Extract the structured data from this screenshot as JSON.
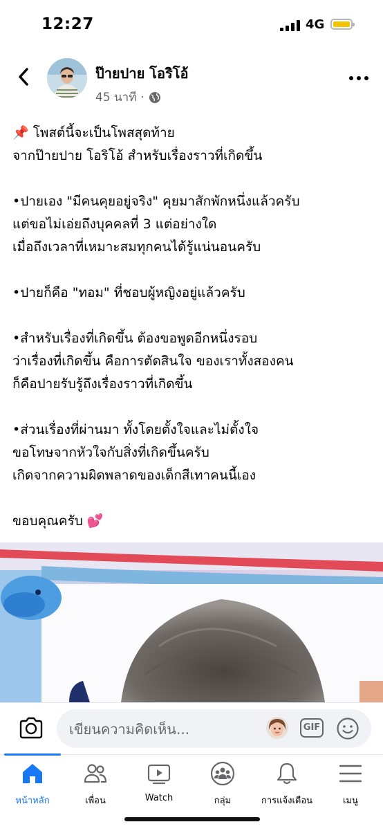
{
  "status_bar": {
    "time": "12:27",
    "network": "4G"
  },
  "post": {
    "author": "ป๊ายปาย โอริโอ้",
    "time_ago": "45 นาที",
    "separator": "·",
    "paragraphs": [
      [
        "📌 โพสต์นี้จะเป็นโพสสุดท้าย",
        "จากป๊ายปาย โอริโอ้ สำหรับเรื่องราวที่เกิดขึ้น"
      ],
      [
        "•ปายเอง \"มีคนคุยอยู่จริง\" คุยมาสักพักหนึ่งแล้วครับ",
        "แต่ขอไม่เอ่ยถึงบุคคลที่ 3 แต่อย่างใด",
        "เมื่อถึงเวลาที่เหมาะสมทุกคนได้รู้แน่นอนครับ"
      ],
      [
        "•ปายก็คือ \"ทอม\" ที่ชอบผู้หญิงอยู่แล้วครับ"
      ],
      [
        "•สำหรับเรื่องที่เกิดขึ้น ต้องขอพูดอีกหนึ่งรอบ",
        "ว่าเรื่องที่เกิดขึ้น คือการตัดสินใจ ของเราทั้งสองคน",
        "ก็คือปายรับรู้ถึงเรื่องราวที่เกิดขึ้น"
      ],
      [
        "•ส่วนเรื่องที่ผ่านมา ทั้งโดยตั้งใจและไม่ตั้งใจ",
        "ขอโทษจากหัวใจกับสิ่งที่เกิดขึ้นครับ",
        "เกิดจากความผิดพลาดของเด็กสีเทาคนนี้เอง"
      ],
      [
        "ขอบคุณครับ 💕"
      ]
    ]
  },
  "comment": {
    "placeholder": "เขียนความคิดเห็น...",
    "gif_label": "GIF"
  },
  "tabs": [
    {
      "label": "หน้าหลัก",
      "icon": "home-icon",
      "active": true
    },
    {
      "label": "เพื่อน",
      "icon": "friends-icon",
      "active": false
    },
    {
      "label": "Watch",
      "icon": "watch-icon",
      "active": false
    },
    {
      "label": "กลุ่ม",
      "icon": "groups-icon",
      "active": false
    },
    {
      "label": "การแจ้งเตือน",
      "icon": "bell-icon",
      "active": false
    },
    {
      "label": "เมนู",
      "icon": "menu-icon",
      "active": false
    }
  ],
  "colors": {
    "accent": "#1877f2",
    "secondary_text": "#65676b",
    "battery": "#f5c400"
  }
}
